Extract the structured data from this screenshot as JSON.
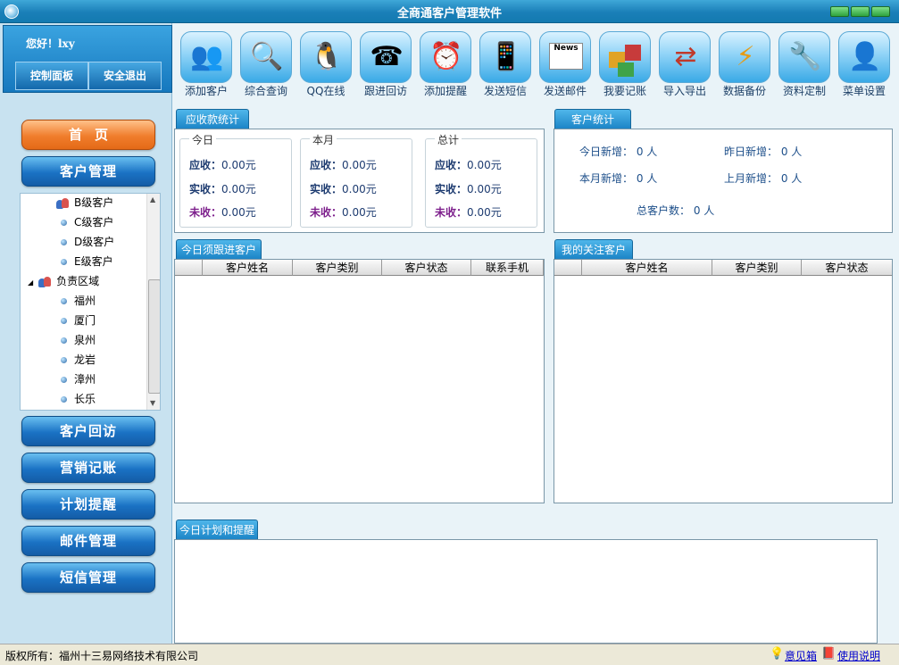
{
  "window": {
    "title": "全商通客户管理软件"
  },
  "user": {
    "greeting": "您好！lxy",
    "control_panel": "控制面板",
    "logout": "安全退出"
  },
  "nav": {
    "home": "首页",
    "customer_mgmt": "客户管理",
    "customer_visit": "客户回访",
    "marketing": "营销记账",
    "plan": "计划提醒",
    "mail": "邮件管理",
    "sms": "短信管理"
  },
  "tree": {
    "items": [
      "B级客户",
      "C级客户",
      "D级客户",
      "E级客户",
      "负责区域",
      "福州",
      "厦门",
      "泉州",
      "龙岩",
      "漳州",
      "长乐"
    ]
  },
  "toolbar": {
    "items": [
      "添加客户",
      "综合查询",
      "QQ在线",
      "跟进回访",
      "添加提醒",
      "发送短信",
      "发送邮件",
      "我要记账",
      "导入导出",
      "数据备份",
      "资料定制",
      "菜单设置"
    ],
    "news_text": "News"
  },
  "receivables": {
    "title": "应收款统计",
    "groups": [
      {
        "name": "今日",
        "due_label": "应收：",
        "due": "0.00元",
        "paid_label": "实收：",
        "paid": "0.00元",
        "unpaid_label": "未收：",
        "unpaid": "0.00元"
      },
      {
        "name": "本月",
        "due_label": "应收：",
        "due": "0.00元",
        "paid_label": "实收：",
        "paid": "0.00元",
        "unpaid_label": "未收：",
        "unpaid": "0.00元"
      },
      {
        "name": "总计",
        "due_label": "应收：",
        "due": "0.00元",
        "paid_label": "实收：",
        "paid": "0.00元",
        "unpaid_label": "未收：",
        "unpaid": "0.00元"
      }
    ]
  },
  "customer_stats": {
    "title": "客户统计",
    "today_new": "今日新增： 0 人",
    "yesterday_new": "昨日新增： 0 人",
    "month_new": "本月新增： 0 人",
    "last_month_new": "上月新增： 0 人",
    "total": "总客户数： 0 人"
  },
  "followup": {
    "title": "今日须跟进客户",
    "columns": [
      "客户姓名",
      "客户类别",
      "客户状态",
      "联系手机"
    ]
  },
  "watch": {
    "title": "我的关注客户",
    "columns": [
      "客户姓名",
      "客户类别",
      "客户状态"
    ]
  },
  "today_plan": {
    "title": "今日计划和提醒"
  },
  "status": {
    "copyright": "版权所有：福州十三易网络技术有限公司",
    "feedback": "意见箱",
    "help": "使用说明"
  }
}
